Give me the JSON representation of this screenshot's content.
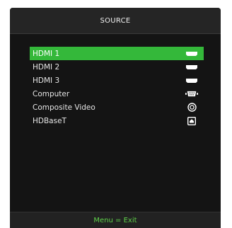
{
  "header": {
    "title": "SOURCE"
  },
  "sources": [
    {
      "label": "HDMI 1",
      "icon": "hdmi-icon",
      "selected": true
    },
    {
      "label": "HDMI 2",
      "icon": "hdmi-icon",
      "selected": false
    },
    {
      "label": "HDMI 3",
      "icon": "hdmi-icon",
      "selected": false
    },
    {
      "label": "Computer",
      "icon": "vga-icon",
      "selected": false
    },
    {
      "label": "Composite Video",
      "icon": "composite-icon",
      "selected": false
    },
    {
      "label": "HDBaseT",
      "icon": "hdbaset-icon",
      "selected": false
    }
  ],
  "footer": {
    "hint": "Menu = Exit"
  },
  "colors": {
    "accent": "#34b83a",
    "footer_text": "#5fd04a",
    "background": "#141414"
  }
}
